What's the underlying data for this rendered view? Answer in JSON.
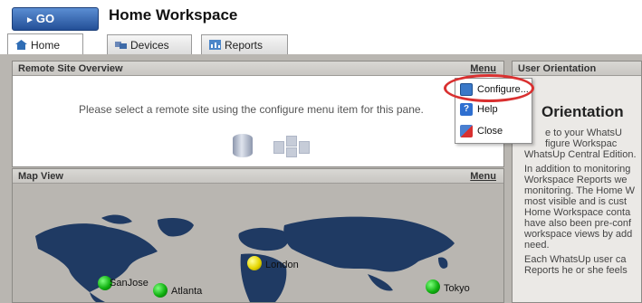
{
  "header": {
    "go_label": "GO",
    "title": "Home Workspace"
  },
  "tabs": [
    {
      "label": "Home",
      "icon": "home-icon",
      "active": true
    },
    {
      "label": "Devices",
      "icon": "devices-icon",
      "active": false
    },
    {
      "label": "Reports",
      "icon": "reports-icon",
      "active": false
    }
  ],
  "remote_panel": {
    "title": "Remote Site Overview",
    "menu_label": "Menu",
    "message": "Please select a remote site using the configure menu item for this pane."
  },
  "dropdown": {
    "items": [
      {
        "label": "Configure...",
        "icon": "configure-icon"
      },
      {
        "label": "Help",
        "icon": "help-icon"
      },
      {
        "label": "Close",
        "icon": "close-icon"
      }
    ]
  },
  "map_panel": {
    "title": "Map View",
    "menu_label": "Menu",
    "cities": [
      {
        "name": "SanJose",
        "status": "up",
        "color": "#10b010"
      },
      {
        "name": "Atlanta",
        "status": "up",
        "color": "#10b010"
      },
      {
        "name": "London",
        "status": "warning",
        "color": "#e6d600"
      },
      {
        "name": "Tokyo",
        "status": "up",
        "color": "#10b010"
      }
    ]
  },
  "orientation_panel": {
    "title": "User Orientation",
    "heading": "Orientation",
    "lines": [
      "e to your WhatsU",
      "figure Workspac",
      "WhatsUp Central Edition.",
      "In addition to monitoring",
      "Workspace Reports we",
      "monitoring. The Home W",
      "most visible and is cust",
      "Home Workspace conta",
      "have also been pre-conf",
      "workspace views by add",
      "need.",
      "Each WhatsUp user ca",
      "Reports he or she feels"
    ]
  },
  "colors": {
    "go_button": "#2f5ea8",
    "workspace_bg": "#b9b6b1",
    "continents": "#1f3a63",
    "highlight": "#d93030"
  }
}
